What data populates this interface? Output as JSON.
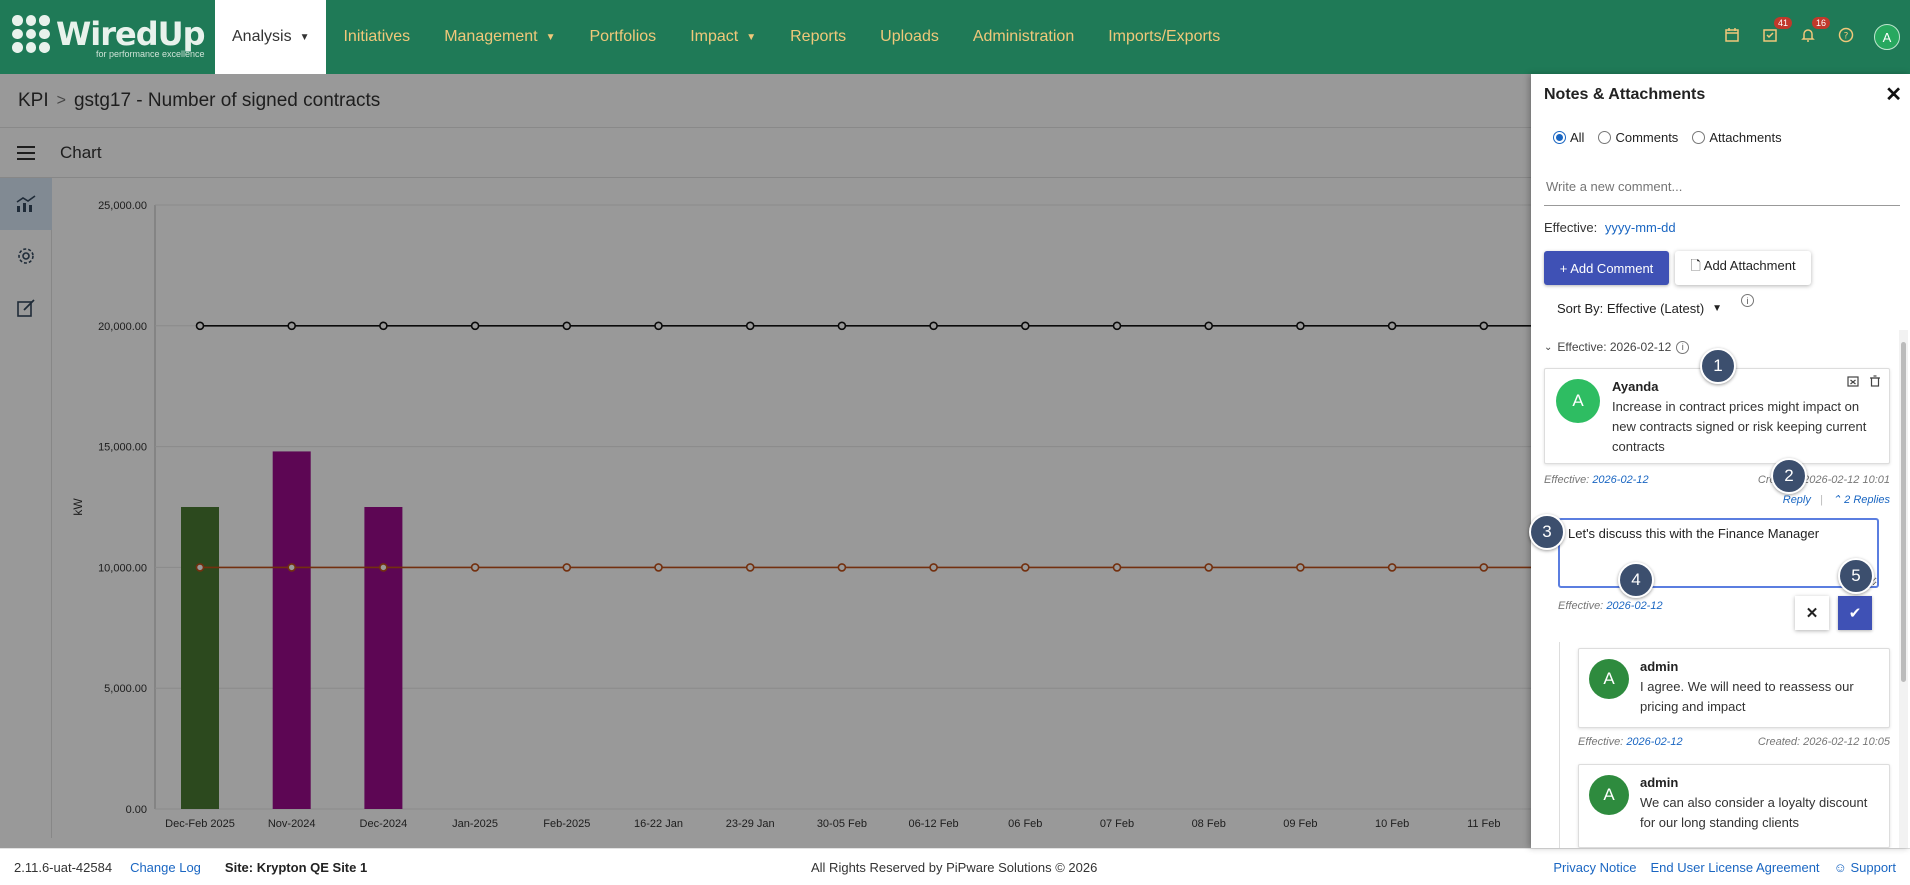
{
  "brand": {
    "name": "WiredUp",
    "tagline": "for performance excellence"
  },
  "nav": {
    "items": [
      {
        "label": "Analysis",
        "caret": "▼",
        "active": true
      },
      {
        "label": "Initiatives"
      },
      {
        "label": "Management",
        "caret": "▼"
      },
      {
        "label": "Portfolios"
      },
      {
        "label": "Impact",
        "caret": "▼"
      },
      {
        "label": "Reports"
      },
      {
        "label": "Uploads"
      },
      {
        "label": "Administration"
      },
      {
        "label": "Imports/Exports"
      }
    ],
    "badges": {
      "tasks": "41",
      "notifications": "16"
    },
    "avatar": "A"
  },
  "breadcrumb": {
    "root": "KPI",
    "sep": ">",
    "current": "gstg17 - Number of signed contracts"
  },
  "subheader": {
    "title": "Chart"
  },
  "chart_data": {
    "type": "bar",
    "categories": [
      "Dec-Feb 2025",
      "Nov-2024",
      "Dec-2024",
      "Jan-2025",
      "Feb-2025",
      "16-22 Jan",
      "23-29 Jan",
      "30-05 Feb",
      "06-12 Feb",
      "06 Feb",
      "07 Feb",
      "08 Feb",
      "09 Feb",
      "10 Feb",
      "11 Feb"
    ],
    "ylabel": "kW",
    "ylim": [
      0,
      25000
    ],
    "yticks": [
      "0.00",
      "5,000.00",
      "10,000.00",
      "15,000.00",
      "20,000.00",
      "25,000.00"
    ],
    "grid": true,
    "series": [
      {
        "type": "bar",
        "values": [
          12500,
          14800,
          12500,
          null,
          null,
          null,
          null,
          null,
          null,
          null,
          null,
          null,
          null,
          null,
          null
        ],
        "colors": [
          "#4a7a32",
          "#9b0a8c",
          "#9b0a8c"
        ]
      },
      {
        "type": "line",
        "color": "#111111",
        "values": [
          20000,
          20000,
          20000,
          20000,
          20000,
          20000,
          20000,
          20000,
          20000,
          20000,
          20000,
          20000,
          20000,
          20000,
          20000
        ]
      },
      {
        "type": "line",
        "color": "#c0501a",
        "values": [
          10000,
          10000,
          10000,
          10000,
          10000,
          10000,
          10000,
          10000,
          10000,
          10000,
          10000,
          10000,
          10000,
          10000,
          10000
        ]
      }
    ]
  },
  "panel": {
    "title": "Notes & Attachments",
    "close": "✕",
    "filters": [
      "All",
      "Comments",
      "Attachments"
    ],
    "selected_filter": "All",
    "new_comment_placeholder": "Write a new comment...",
    "effective_label": "Effective:",
    "effective_placeholder": "yyyy-mm-dd",
    "add_comment": "+ Add Comment",
    "add_attachment": "Add Attachment",
    "sort_label": "Sort By: Effective (Latest)",
    "group_label": "Effective: 2026-02-12",
    "comment": {
      "avatar": "A",
      "author": "Ayanda",
      "text": "Increase in contract prices might impact on new contracts signed or risk keeping current contracts",
      "effective_label": "Effective:",
      "effective_date": "2026-02-12",
      "created": "Created: 2026-02-12 10:01",
      "reply": "Reply",
      "replies": "2 Replies"
    },
    "reply_draft": {
      "value": "Let's discuss this with the Finance Manager",
      "effective_label": "Effective:",
      "effective_date": "2026-02-12"
    },
    "replies": [
      {
        "avatar": "A",
        "author": "admin",
        "text": "I agree. We will need to reassess our pricing and impact",
        "effective_label": "Effective:",
        "effective_date": "2026-02-12",
        "created": "Created: 2026-02-12 10:05"
      },
      {
        "avatar": "A",
        "author": "admin",
        "text": "We can also consider a loyalty discount for our long standing clients"
      }
    ],
    "steps": [
      "1",
      "2",
      "3",
      "4",
      "5"
    ]
  },
  "footer": {
    "version": "2.11.6-uat-42584",
    "change_log": "Change Log",
    "site": "Site: Krypton QE Site 1",
    "rights": "All Rights Reserved by PiPware Solutions © 2026",
    "privacy": "Privacy Notice",
    "eula": "End User License Agreement",
    "support": "Support"
  }
}
